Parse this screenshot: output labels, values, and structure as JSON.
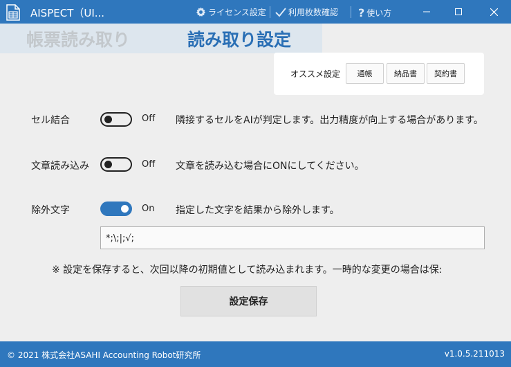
{
  "window": {
    "title": "AISPECT（UI...",
    "links": {
      "license": "ライセンス設定",
      "usage": "利用枚数確認",
      "help": "使い方"
    }
  },
  "tabs": [
    {
      "label": "帳票読み取り"
    },
    {
      "label": "読み取り設定"
    }
  ],
  "recommended": {
    "label": "オススメ設定",
    "buttons": [
      "通帳",
      "納品書",
      "契約書"
    ]
  },
  "settings": {
    "cell_merge": {
      "label": "セル結合",
      "state": "Off",
      "description": "隣接するセルをAIが判定します。出力精度が向上する場合があります。"
    },
    "sentence_read": {
      "label": "文章読み込み",
      "state": "Off",
      "description": "文章を読み込む場合にONにしてください。"
    },
    "exclude_chars": {
      "label": "除外文字",
      "state": "On",
      "description": "指定した文字を結果から除外します。",
      "value": "*;\\;|;√;"
    }
  },
  "note": "※ 設定を保存すると、次回以降の初期値として読み込まれます。一時的な変更の場合は保:",
  "save_button": "設定保存",
  "footer": {
    "copyright": "© 2021 株式会社ASAHI Accounting Robot研究所",
    "version": "v1.0.5.211013"
  },
  "colors": {
    "accent": "#2f77bd",
    "active_tab": "#2a6fb5",
    "inactive_tab": "#c3c8cc"
  }
}
